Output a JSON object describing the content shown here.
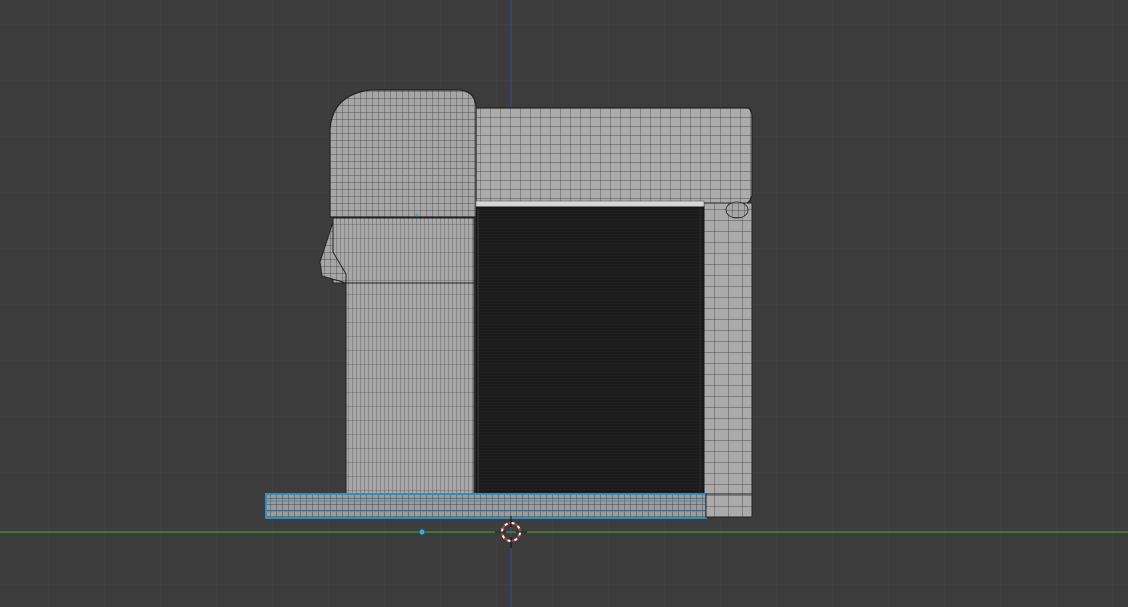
{
  "viewport": {
    "view": "front-orthographic",
    "shading": "wireframe-overlay",
    "background_color": "#3c3c3c",
    "grid_color": "#474747",
    "x_axis_color": "#3c8a2c",
    "z_axis_color": "#3d3f8c",
    "mesh_fill_color": "#a9a9a9",
    "mesh_wire_color": "#2b2b2b",
    "dark_panel_color": "#1c1c1c",
    "selection_color": "#2f8fc4",
    "cursor_color": "#c83232"
  },
  "objects": [
    {
      "name": "coffee-machine-body",
      "selected": false
    },
    {
      "name": "drip-tray",
      "selected": true
    }
  ],
  "icons": {
    "cursor": "3d-cursor-icon",
    "origin": "object-origin-icon"
  }
}
